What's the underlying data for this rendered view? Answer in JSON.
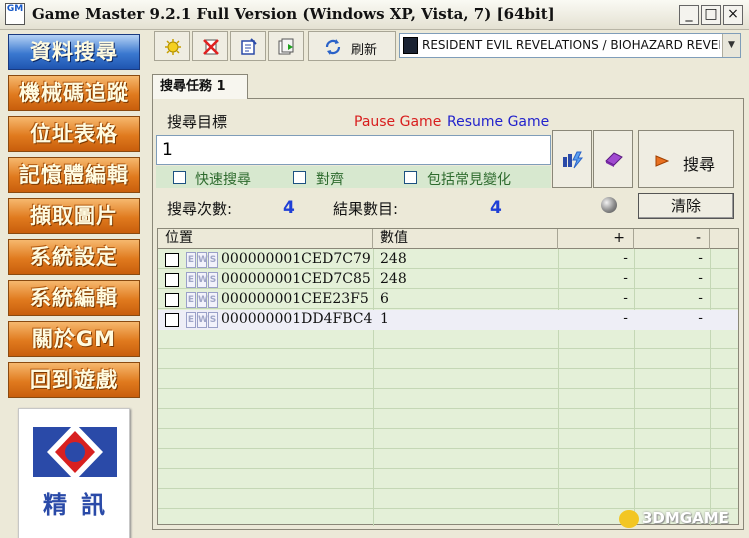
{
  "window": {
    "title": "Game Master 9.2.1 Full Version (Windows XP, Vista, 7) [64bit]",
    "icon_text": "GM",
    "controls": [
      "_",
      "□",
      "×"
    ]
  },
  "sidebar": {
    "items": [
      {
        "label": "資料搜尋",
        "active": true
      },
      {
        "label": "機械碼追蹤",
        "active": false
      },
      {
        "label": "位址表格",
        "active": false
      },
      {
        "label": "記憶體編輯",
        "active": false
      },
      {
        "label": "擷取圖片",
        "active": false
      },
      {
        "label": "系統設定",
        "active": false
      },
      {
        "label": "系統編輯",
        "active": false
      },
      {
        "label": "關於GM",
        "active": false
      },
      {
        "label": "回到遊戲",
        "active": false
      }
    ],
    "logo_text": "精訊"
  },
  "toolbar": {
    "refresh_label": "刷新",
    "process": "RESIDENT EVIL REVELATIONS / BIOHAZARD REVELA",
    "icons": [
      "new-search-icon",
      "delete-search-icon",
      "save-search-icon",
      "load-search-icon",
      "refresh-icon"
    ]
  },
  "tab": {
    "label": "搜尋任務 1"
  },
  "search": {
    "target_label": "搜尋目標",
    "pause_label": "Pause Game",
    "resume_label": "Resume Game",
    "value": "1",
    "search_button": "搜尋",
    "options": [
      {
        "label": "快速搜尋",
        "checked": false
      },
      {
        "label": "對齊",
        "checked": false
      },
      {
        "label": "包括常見變化",
        "checked": false
      }
    ]
  },
  "stats": {
    "search_count_label": "搜尋次數:",
    "search_count": "4",
    "result_count_label": "結果數目:",
    "result_count": "4",
    "clear_button": "清除"
  },
  "results": {
    "columns": [
      "位置",
      "數值",
      "+",
      "-"
    ],
    "ews_letters": [
      "E",
      "W",
      "S"
    ],
    "rows": [
      {
        "address": "000000001CED7C79",
        "value": "248",
        "plus": "-",
        "minus": "-"
      },
      {
        "address": "000000001CED7C85",
        "value": "248",
        "plus": "-",
        "minus": "-"
      },
      {
        "address": "000000001CEE23F5",
        "value": "6",
        "plus": "-",
        "minus": "-"
      },
      {
        "address": "000000001DD4FBC4",
        "value": "1",
        "plus": "-",
        "minus": "-"
      }
    ]
  },
  "watermark": "3DMGAME",
  "colors": {
    "sidebar_orange": "#e07a1e",
    "sidebar_active": "#3a78d0",
    "pause": "#d81e1e",
    "resume": "#2222cc",
    "count": "#1f3fd6",
    "grid": "#e4f0d8"
  }
}
